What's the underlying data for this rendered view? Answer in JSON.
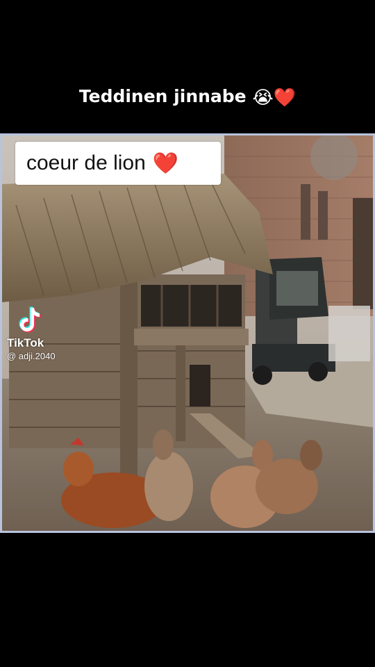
{
  "caption": {
    "text": "Teddinen jinnabe",
    "emojis": "😭❤️"
  },
  "sticker": {
    "text": "coeur de lion",
    "heart": "❤️"
  },
  "watermark": {
    "icon": "tiktok-note-icon",
    "brand": "TikTok",
    "username": "@ adji.2040"
  },
  "colors": {
    "background": "#000000",
    "frame_border": "#b9c3dc",
    "heart": "#e0182c"
  }
}
